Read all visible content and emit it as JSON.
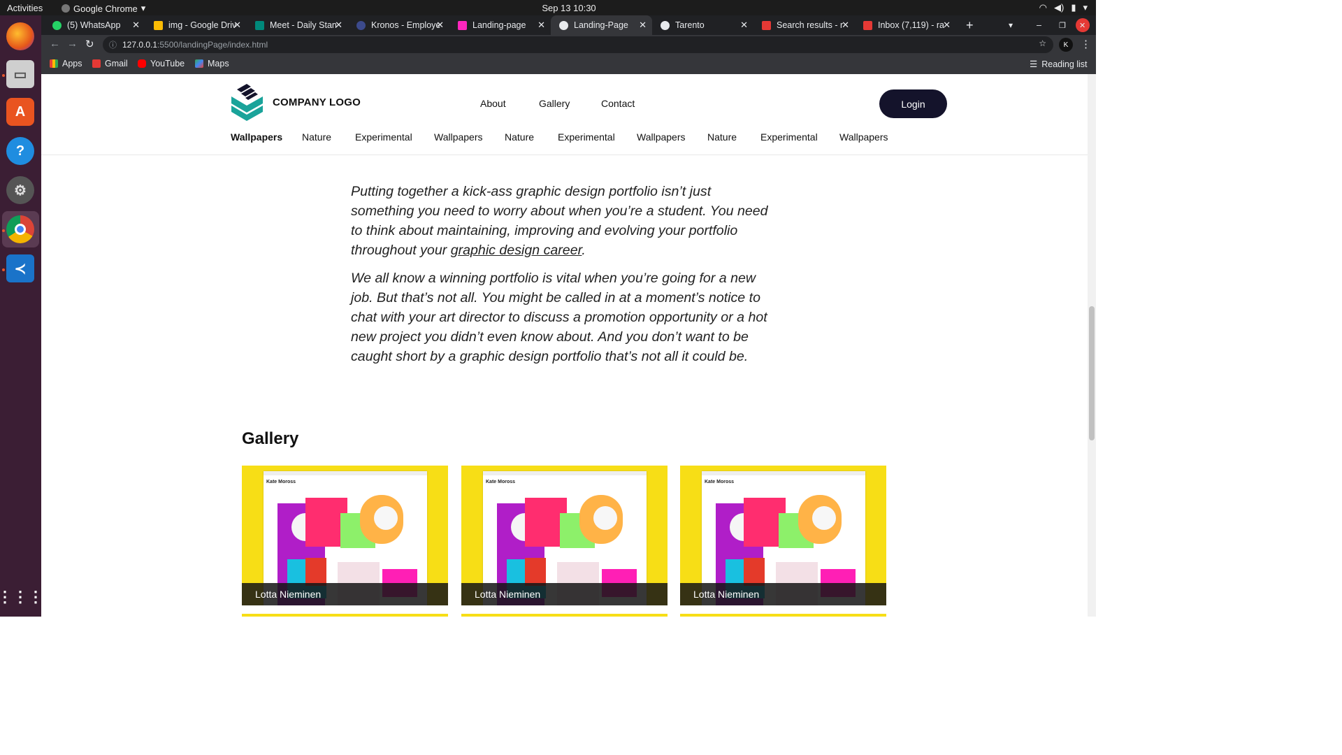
{
  "os": {
    "activities": "Activities",
    "app_name": "Google Chrome",
    "clock": "Sep 13  10:30"
  },
  "browser": {
    "tabs": [
      {
        "label": "(5) WhatsApp",
        "color": "#25d366"
      },
      {
        "label": "img - Google Driv",
        "color": "#fbbc04"
      },
      {
        "label": "Meet - Daily Stan",
        "color": "#00897b"
      },
      {
        "label": "Kronos - Employe",
        "color": "#3c4a8c"
      },
      {
        "label": "Landing-page",
        "color": "#ff26be"
      },
      {
        "label": "Landing-Page",
        "color": "#e8eaed"
      },
      {
        "label": "Tarento",
        "color": "#e8eaed"
      },
      {
        "label": "Search results - r",
        "color": "#e53935"
      },
      {
        "label": "Inbox (7,119) - ra",
        "color": "#e53935"
      }
    ],
    "url_host": "127.0.0.1",
    "url_path": ":5500/landingPage/index.html",
    "bookmarks": [
      "Apps",
      "Gmail",
      "YouTube",
      "Maps"
    ],
    "reading_list": "Reading list"
  },
  "page": {
    "logo_text": "COMPANY LOGO",
    "nav": [
      "About",
      "Gallery",
      "Contact"
    ],
    "login": "Login",
    "categories": [
      "Wallpapers",
      "Nature",
      "Experimental",
      "Wallpapers",
      "Nature",
      "Experimental",
      "Wallpapers",
      "Nature",
      "Experimental",
      "Wallpapers"
    ],
    "article": {
      "p1_text": "Putting together a kick-ass graphic design portfolio isn’t just something you need to worry about when you’re a student. You need to think about maintaining, improving and evolving your portfolio throughout your ",
      "p1_link": "graphic design career",
      "p1_end": ".",
      "p2": "We all know a winning portfolio is vital when you’re going for a new job. But that’s not all. You might be called in at a moment’s notice to chat with your art director to discuss a promotion opportunity or a hot new project you didn’t even know about. And you don’t want to be caught short by a graphic design portfolio that’s not all it could be."
    },
    "gallery_title": "Gallery",
    "gallery": [
      {
        "caption": "Lotta Nieminen",
        "shot_name": "Kate Moross"
      },
      {
        "caption": "Lotta Nieminen",
        "shot_name": "Kate Moross"
      },
      {
        "caption": "Lotta Nieminen",
        "shot_name": "Kate Moross"
      }
    ]
  },
  "colors": {
    "login_bg": "#14132b",
    "logo_teal": "#1aa39a",
    "gallery_yellow": "#f7de16"
  }
}
